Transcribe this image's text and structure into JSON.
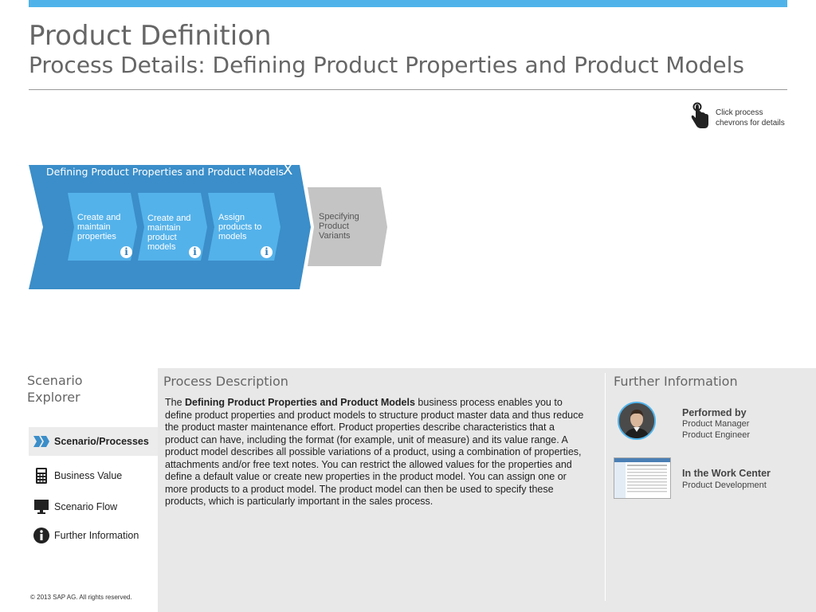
{
  "header": {
    "title": "Product Definition",
    "subtitle": "Process Details: Defining Product Properties and Product Models",
    "hint": "Click process chevrons for details"
  },
  "process": {
    "name": "Defining Product Properties and Product Models",
    "close_label": "X",
    "steps": [
      {
        "label": "Create and maintain properties",
        "info": "i"
      },
      {
        "label": "Create and maintain product models",
        "info": "i"
      },
      {
        "label": "Assign products to models",
        "info": "i"
      }
    ],
    "next_process": "Specifying Product Variants",
    "colors": {
      "active": "#3b8ec9",
      "step": "#54b2ea",
      "inactive": "#c4c4c4"
    }
  },
  "explorer": {
    "title": "Scenario Explorer",
    "items": [
      {
        "label": "Scenario/Processes",
        "icon": "chevrons-icon",
        "active": true
      },
      {
        "label": "Business Value",
        "icon": "calculator-icon",
        "active": false
      },
      {
        "label": "Scenario Flow",
        "icon": "monitor-icon",
        "active": false
      },
      {
        "label": "Further Information",
        "icon": "info-icon",
        "active": false
      }
    ],
    "copyright": "©  2013 SAP AG. All rights reserved."
  },
  "description": {
    "title": "Process Description",
    "intro": "The ",
    "bold": "Defining Product Properties and Product Models",
    "body": " business process enables you to define product properties and product models to structure product master data and thus reduce the product master maintenance effort. Product properties describe characteristics that a product can have, including the format (for example, unit of measure) and its value range. A product model describes all possible variations of a product, using a combination of properties, attachments and/or free text notes. You can restrict the allowed values for the properties and define a default value or create new properties in the product model. You can assign one or more products to a product model. The product model can then be used to specify these products, which is particularly important in the sales process."
  },
  "further_info": {
    "title": "Further Information",
    "performed_by": {
      "heading": "Performed by",
      "lines": [
        "Product Manager",
        "Product Engineer"
      ]
    },
    "work_center": {
      "heading": "In the Work Center",
      "lines": [
        "Product Development"
      ]
    }
  }
}
